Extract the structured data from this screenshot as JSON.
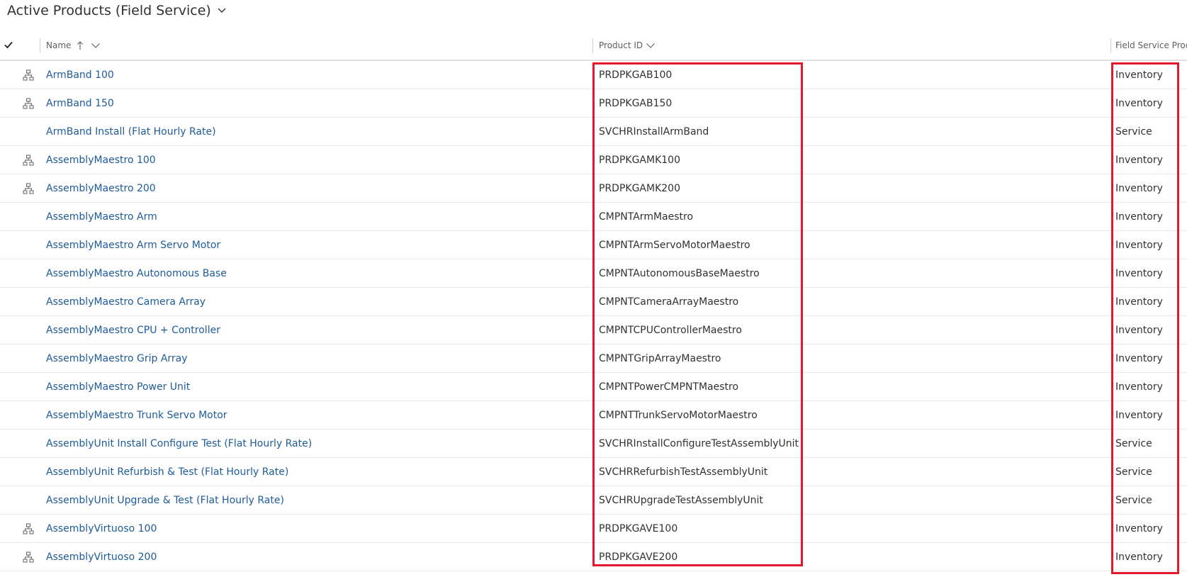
{
  "view": {
    "title": "Active Products (Field Service)",
    "title_chevron_icon": "chevron-down-icon"
  },
  "columns": {
    "select_icon": "checkmark-icon",
    "name": "Name",
    "name_sort_icon": "sort-ascending-arrow-icon",
    "name_menu_icon": "chevron-down-icon",
    "product_id": "Product ID",
    "product_id_menu_icon": "chevron-down-icon",
    "product_type": "Field Service Produ"
  },
  "rows": [
    {
      "name": "ArmBand 100",
      "product_id": "PRDPKGAB100",
      "product_type": "Inventory",
      "kit": true
    },
    {
      "name": "ArmBand 150",
      "product_id": "PRDPKGAB150",
      "product_type": "Inventory",
      "kit": true
    },
    {
      "name": "ArmBand Install (Flat Hourly Rate)",
      "product_id": "SVCHRInstallArmBand",
      "product_type": "Service",
      "kit": false
    },
    {
      "name": "AssemblyMaestro 100",
      "product_id": "PRDPKGAMK100",
      "product_type": "Inventory",
      "kit": true
    },
    {
      "name": "AssemblyMaestro 200",
      "product_id": "PRDPKGAMK200",
      "product_type": "Inventory",
      "kit": true
    },
    {
      "name": "AssemblyMaestro Arm",
      "product_id": "CMPNTArmMaestro",
      "product_type": "Inventory",
      "kit": false
    },
    {
      "name": "AssemblyMaestro Arm Servo Motor",
      "product_id": "CMPNTArmServoMotorMaestro",
      "product_type": "Inventory",
      "kit": false
    },
    {
      "name": "AssemblyMaestro Autonomous Base",
      "product_id": "CMPNTAutonomousBaseMaestro",
      "product_type": "Inventory",
      "kit": false
    },
    {
      "name": "AssemblyMaestro Camera Array",
      "product_id": "CMPNTCameraArrayMaestro",
      "product_type": "Inventory",
      "kit": false
    },
    {
      "name": "AssemblyMaestro CPU + Controller",
      "product_id": "CMPNTCPUControllerMaestro",
      "product_type": "Inventory",
      "kit": false
    },
    {
      "name": "AssemblyMaestro Grip Array",
      "product_id": "CMPNTGripArrayMaestro",
      "product_type": "Inventory",
      "kit": false
    },
    {
      "name": "AssemblyMaestro Power Unit",
      "product_id": "CMPNTPowerCMPNTMaestro",
      "product_type": "Inventory",
      "kit": false
    },
    {
      "name": "AssemblyMaestro Trunk Servo Motor",
      "product_id": "CMPNTTrunkServoMotorMaestro",
      "product_type": "Inventory",
      "kit": false
    },
    {
      "name": "AssemblyUnit Install Configure Test (Flat Hourly Rate)",
      "product_id": "SVCHRInstallConfigureTestAssemblyUnit",
      "product_type": "Service",
      "kit": false
    },
    {
      "name": "AssemblyUnit Refurbish & Test (Flat Hourly Rate)",
      "product_id": "SVCHRRefurbishTestAssemblyUnit",
      "product_type": "Service",
      "kit": false
    },
    {
      "name": "AssemblyUnit Upgrade & Test (Flat Hourly Rate)",
      "product_id": "SVCHRUpgradeTestAssemblyUnit",
      "product_type": "Service",
      "kit": false
    },
    {
      "name": "AssemblyVirtuoso 100",
      "product_id": "PRDPKGAVE100",
      "product_type": "Inventory",
      "kit": true
    },
    {
      "name": "AssemblyVirtuoso 200",
      "product_id": "PRDPKGAVE200",
      "product_type": "Inventory",
      "kit": true
    }
  ],
  "colors": {
    "link": "#1d5b9a",
    "highlight_box": "#e3182d",
    "header_text": "#605e5c"
  }
}
